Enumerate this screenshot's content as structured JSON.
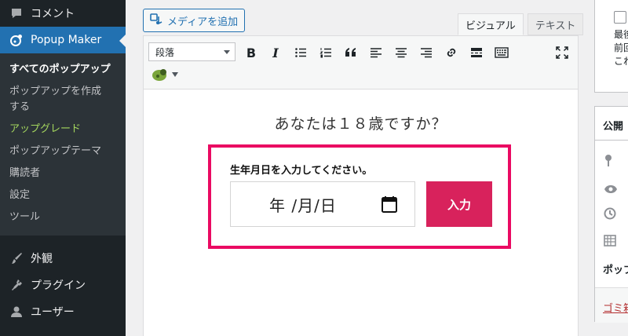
{
  "sidebar": {
    "comments_label": "コメント",
    "popup_maker_label": "Popup Maker",
    "submenu": [
      "すべてのポップアップ",
      "ポップアップを作成する",
      "アップグレード",
      "ポップアップテーマ",
      "購読者",
      "設定",
      "ツール"
    ],
    "appearance_label": "外観",
    "plugins_label": "プラグイン",
    "users_label": "ユーザー"
  },
  "editor": {
    "add_media_label": "メディアを追加",
    "tab_visual": "ビジュアル",
    "tab_text": "テキスト",
    "format_select_value": "段落"
  },
  "content": {
    "heading": "あなたは１８歳ですか？",
    "popup_label": "生年月日を入力してください。",
    "date_placeholder": "年 /月/日",
    "submit_label": "入力"
  },
  "right_panel": {
    "box1_line1": "最後",
    "box1_line2": "前回",
    "box1_line3": "これ",
    "publish_title": "公開",
    "popup_label": "ポップ",
    "trash_link": "ゴミ箱"
  },
  "colors": {
    "sidebar_bg": "#1d2327",
    "accent": "#2271b1",
    "popup_border": "#ea0a62",
    "submit_bg": "#d8225c",
    "upgrade_text": "#a4d65e"
  }
}
